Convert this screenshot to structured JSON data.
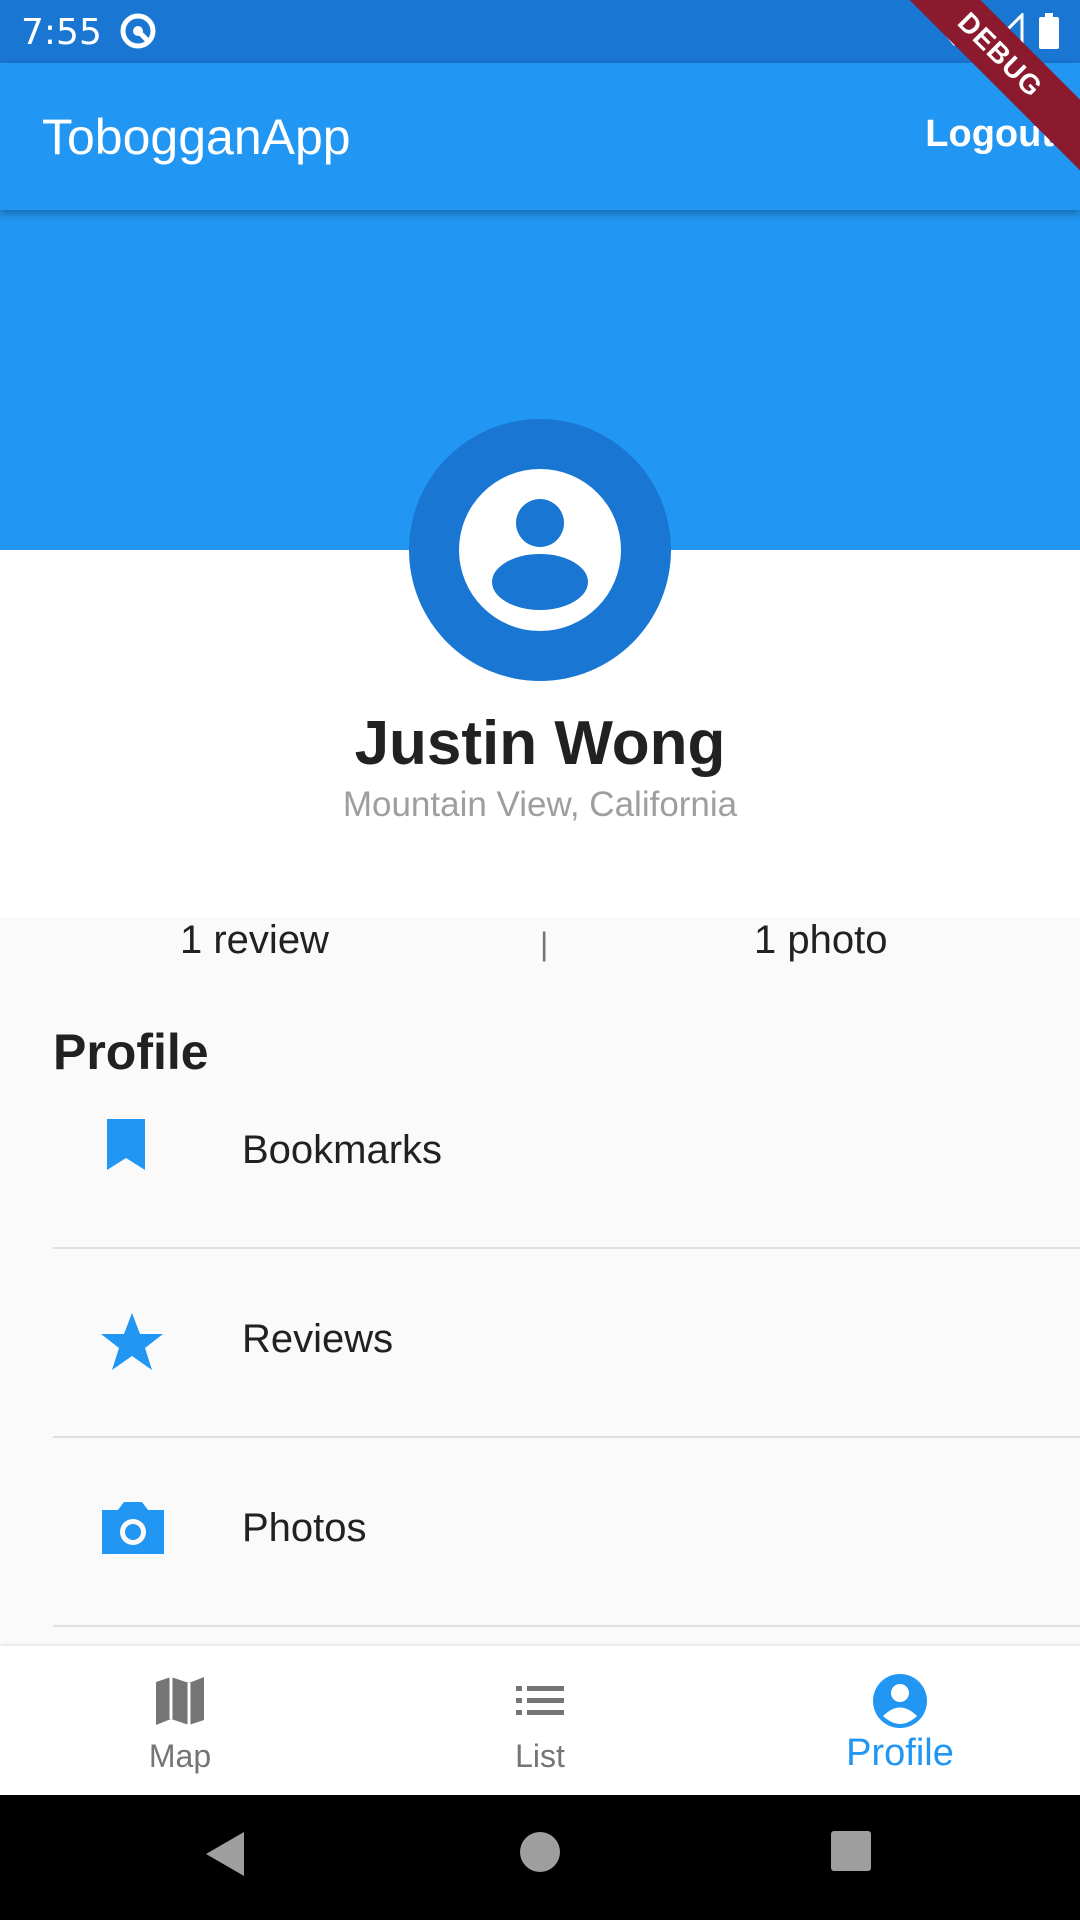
{
  "status_bar": {
    "time": "7:55"
  },
  "app_bar": {
    "title": "TobogganApp",
    "logout_label": "Logout"
  },
  "debug_banner": "DEBUG",
  "profile": {
    "name": "Justin Wong",
    "location": "Mountain View, California",
    "stats": {
      "reviews": "1 review",
      "divider": "|",
      "photos": "1 photo"
    }
  },
  "section_title": "Profile",
  "list_items": [
    {
      "label": "Bookmarks",
      "icon": "bookmark-icon"
    },
    {
      "label": "Reviews",
      "icon": "star-icon"
    },
    {
      "label": "Photos",
      "icon": "camera-icon"
    }
  ],
  "bottom_nav": [
    {
      "label": "Map",
      "icon": "map-icon",
      "active": false
    },
    {
      "label": "List",
      "icon": "list-icon",
      "active": false
    },
    {
      "label": "Profile",
      "icon": "account-circle-icon",
      "active": true
    }
  ],
  "colors": {
    "primary": "#2196f3",
    "primary_dark": "#1976d2",
    "text": "#212121",
    "muted": "#757575"
  }
}
